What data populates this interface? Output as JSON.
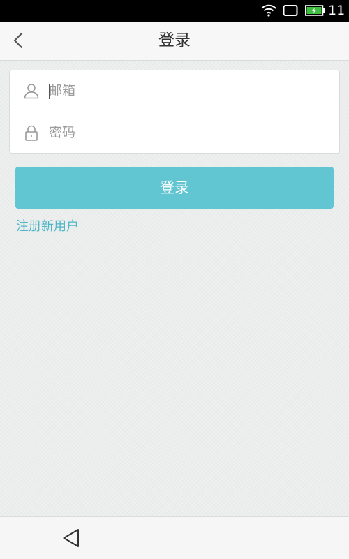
{
  "status_bar": {
    "time": "11",
    "icons": [
      "wifi-icon",
      "recent-apps-icon",
      "battery-charging-icon"
    ]
  },
  "header": {
    "back_icon": "chevron-left-icon",
    "title": "登录"
  },
  "form": {
    "email": {
      "icon": "user-icon",
      "placeholder": "邮箱",
      "value": ""
    },
    "password": {
      "icon": "lock-icon",
      "placeholder": "密码",
      "value": ""
    }
  },
  "login_button": {
    "label": "登录"
  },
  "register_link": {
    "label": "注册新用户"
  },
  "nav_bar": {
    "back_icon": "triangle-back-icon"
  },
  "colors": {
    "accent": "#62c5d2",
    "link": "#4fb6c6",
    "background": "#eef0ef"
  }
}
